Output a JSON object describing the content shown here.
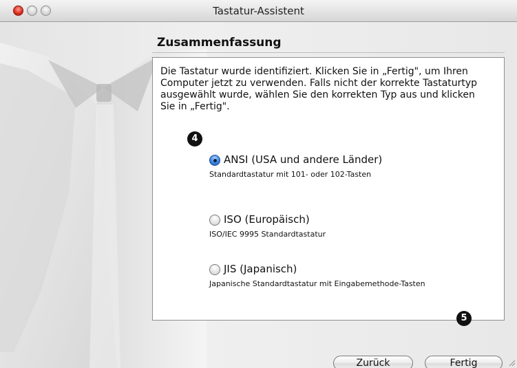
{
  "window": {
    "title": "Tastatur-Assistent"
  },
  "page": {
    "heading": "Zusammenfassung",
    "description": "Die Tastatur wurde identifiziert. Klicken Sie in „Fertig\", um Ihren Computer jetzt zu verwenden. Falls nicht der korrekte Tastaturtyp ausgewählt wurde, wählen Sie den korrekten Typ aus und klicken Sie in „Fertig\"."
  },
  "options": [
    {
      "label": "ANSI (USA und andere Länder)",
      "sub": "Standardtastatur mit 101- oder 102-Tasten",
      "selected": true
    },
    {
      "label": "ISO (Europäisch)",
      "sub": "ISO/IEC 9995 Standardtastatur",
      "selected": false
    },
    {
      "label": "JIS (Japanisch)",
      "sub": "Japanische Standardtastatur mit Eingabemethode-Tasten",
      "selected": false
    }
  ],
  "callouts": {
    "step4": "4",
    "step5": "5"
  },
  "buttons": {
    "back": "Zurück",
    "done": "Fertig"
  },
  "colors": {
    "accent": "#3b84e0",
    "callout": "#111111"
  },
  "icons": [
    "close-icon",
    "minimize-icon",
    "zoom-icon",
    "radio-icon",
    "resize-grip-icon"
  ]
}
